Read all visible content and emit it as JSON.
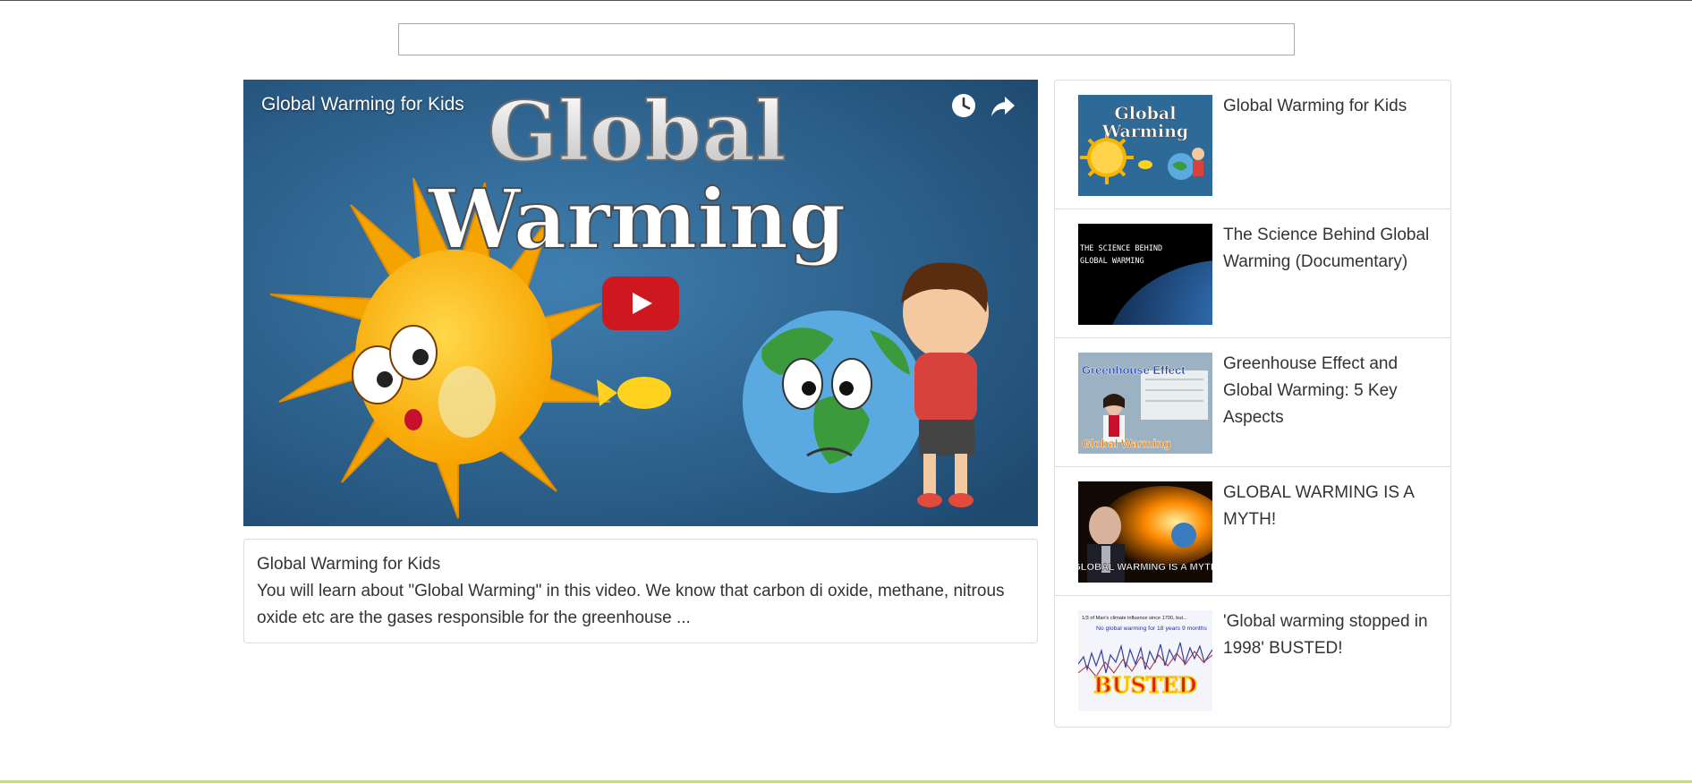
{
  "search": {
    "value": "",
    "placeholder": ""
  },
  "player": {
    "title": "Global Warming for Kids",
    "thumbnail_headline_line1": "Global",
    "thumbnail_headline_line2": "Warming",
    "icons": [
      "watch-later-icon",
      "share-icon",
      "youtube-play-icon"
    ]
  },
  "description": {
    "title": "Global Warming for Kids",
    "text": "You will learn about \"Global Warming\" in this video. We know that carbon di oxide, methane, nitrous oxide etc are the gases responsible for the greenhouse ..."
  },
  "related": {
    "items": [
      {
        "title": "Global Warming for Kids",
        "thumb_text_1": "Global",
        "thumb_text_2": "Warming"
      },
      {
        "title": "The Science Behind Global Warming (Documentary)",
        "thumb_text_1": "THE SCIENCE BEHIND",
        "thumb_text_2": "GLOBAL WARMING"
      },
      {
        "title": "Greenhouse Effect and Global Warming: 5 Key Aspects",
        "thumb_text_1": "Greenhouse Effect",
        "thumb_text_2": "Global Warming"
      },
      {
        "title": "GLOBAL WARMING IS A MYTH!",
        "thumb_text_1": "GLOBAL WARMING IS A MYTH"
      },
      {
        "title": "'Global warming stopped in 1998' BUSTED!",
        "thumb_text_1": "1/3 of Man's climate influence since 1700, but...",
        "thumb_text_2": "No global warming for 18 years 9 months",
        "thumb_text_3": "BUSTED"
      }
    ]
  },
  "colors": {
    "play_button": "#cc181e",
    "border": "#dddddd",
    "text": "#333333",
    "bottom_rule": "#c5d98a"
  }
}
